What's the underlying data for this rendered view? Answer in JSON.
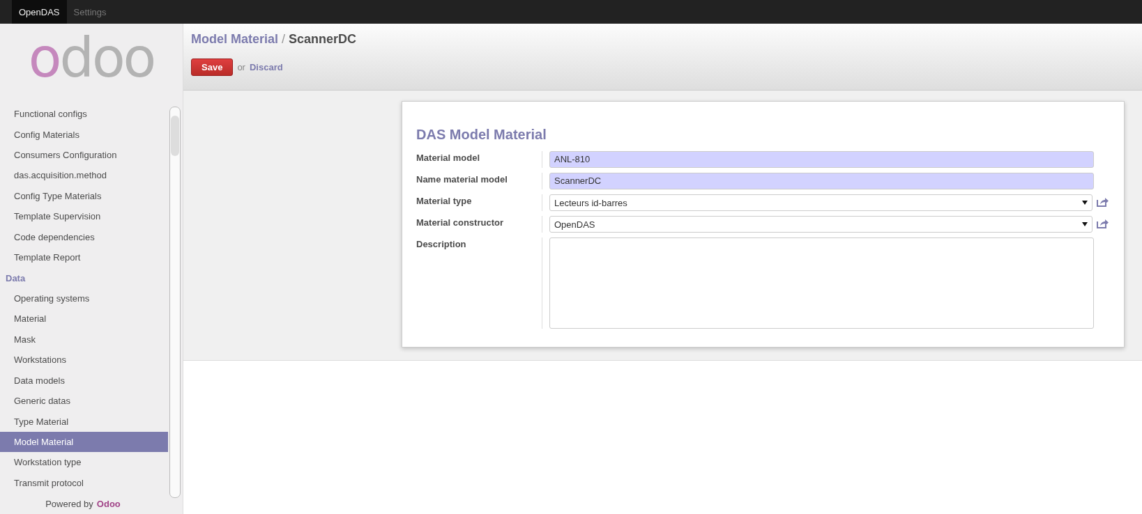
{
  "top_menu": [
    {
      "label": "OpenDAS",
      "selected": true
    },
    {
      "label": "Settings",
      "selected": false
    }
  ],
  "logo": {
    "text": "odoo"
  },
  "sidebar": {
    "items": [
      {
        "kind": "item",
        "label": "Functional configs",
        "selected": false
      },
      {
        "kind": "item",
        "label": "Config Materials",
        "selected": false
      },
      {
        "kind": "item",
        "label": "Consumers Configuration",
        "selected": false
      },
      {
        "kind": "item",
        "label": "das.acquisition.method",
        "selected": false
      },
      {
        "kind": "item",
        "label": "Config Type Materials",
        "selected": false
      },
      {
        "kind": "item",
        "label": "Template Supervision",
        "selected": false
      },
      {
        "kind": "item",
        "label": "Code dependencies",
        "selected": false
      },
      {
        "kind": "item",
        "label": "Template Report",
        "selected": false
      },
      {
        "kind": "header",
        "label": "Data",
        "selected": false
      },
      {
        "kind": "item",
        "label": "Operating systems",
        "selected": false
      },
      {
        "kind": "item",
        "label": "Material",
        "selected": false
      },
      {
        "kind": "item",
        "label": "Mask",
        "selected": false
      },
      {
        "kind": "item",
        "label": "Workstations",
        "selected": false
      },
      {
        "kind": "item",
        "label": "Data models",
        "selected": false
      },
      {
        "kind": "item",
        "label": "Generic datas",
        "selected": false
      },
      {
        "kind": "item",
        "label": "Type Material",
        "selected": false
      },
      {
        "kind": "item",
        "label": "Model Material",
        "selected": true
      },
      {
        "kind": "item",
        "label": "Workstation type",
        "selected": false
      },
      {
        "kind": "item",
        "label": "Transmit protocol",
        "selected": false
      }
    ],
    "footer": {
      "prefix": "Powered by",
      "brand": "Odoo"
    }
  },
  "breadcrumb": {
    "parent": "Model Material",
    "separator": "/",
    "current": "ScannerDC"
  },
  "actions": {
    "save": "Save",
    "or": "or",
    "discard": "Discard"
  },
  "form": {
    "title": "DAS Model Material",
    "fields": [
      {
        "kind": "char",
        "label": "Material model",
        "value": "ANL-810",
        "required": true
      },
      {
        "kind": "char",
        "label": "Name material model",
        "value": "ScannerDC",
        "required": true
      },
      {
        "kind": "selection",
        "label": "Material type",
        "value": "Lecteurs id-barres",
        "required": false
      },
      {
        "kind": "selection",
        "label": "Material constructor",
        "value": "OpenDAS",
        "required": false
      },
      {
        "kind": "text",
        "label": "Description",
        "required": false
      }
    ]
  }
}
